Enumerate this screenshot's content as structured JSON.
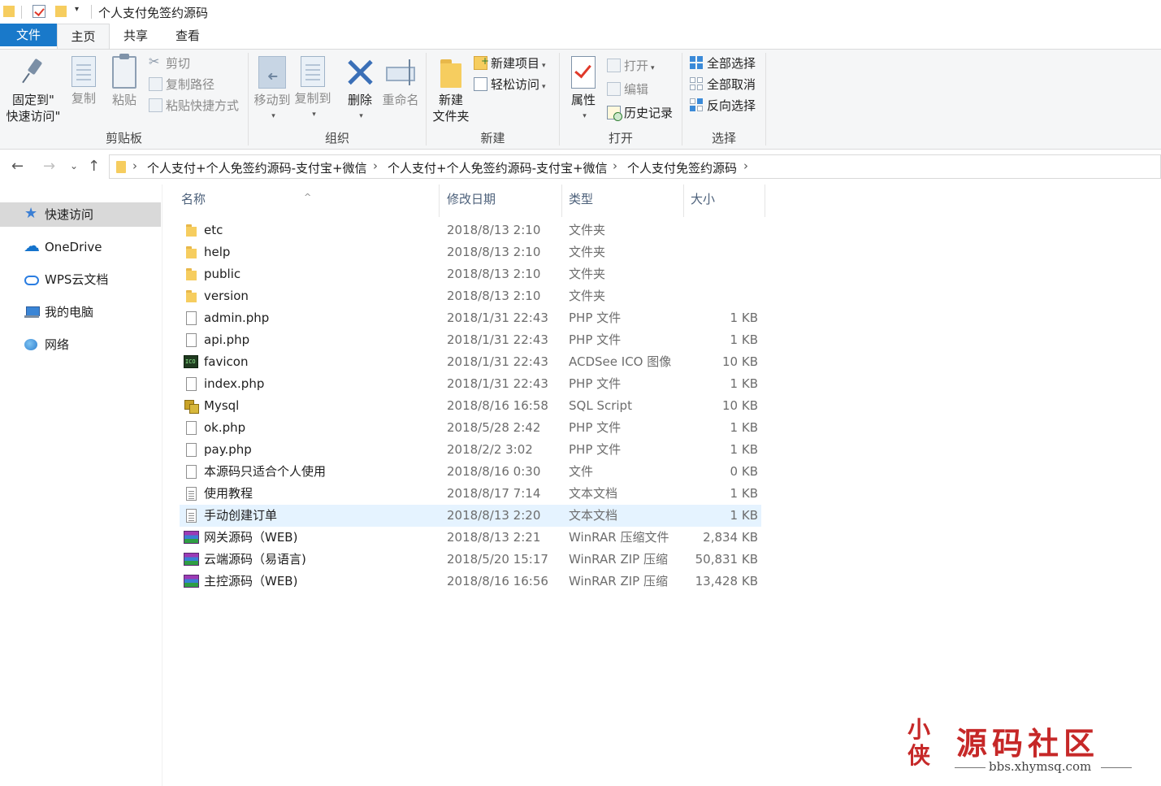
{
  "window": {
    "title": "个人支付免签约源码"
  },
  "ribbon_tabs": {
    "file": "文件",
    "home": "主页",
    "share": "共享",
    "view": "查看"
  },
  "ribbon": {
    "clipboard": {
      "label": "剪贴板",
      "pin_line1": "固定到\"",
      "pin_line2": "快速访问\"",
      "copy": "复制",
      "paste": "粘贴",
      "cut": "剪切",
      "copy_path": "复制路径",
      "paste_shortcut": "粘贴快捷方式"
    },
    "organize": {
      "label": "组织",
      "move_to": "移动到",
      "copy_to": "复制到",
      "delete": "删除",
      "rename": "重命名"
    },
    "new": {
      "label": "新建",
      "new_folder_line1": "新建",
      "new_folder_line2": "文件夹",
      "new_item": "新建项目",
      "easy_access": "轻松访问"
    },
    "open": {
      "label": "打开",
      "properties": "属性",
      "open": "打开",
      "edit": "编辑",
      "history": "历史记录"
    },
    "select": {
      "label": "选择",
      "select_all": "全部选择",
      "select_none": "全部取消",
      "invert": "反向选择"
    }
  },
  "address": {
    "crumbs": [
      "个人支付+个人免签约源码-支付宝+微信",
      "个人支付+个人免签约源码-支付宝+微信",
      "个人支付免签约源码"
    ]
  },
  "nav_pane": {
    "items": [
      {
        "label": "快速访问",
        "icon": "star-icon"
      },
      {
        "label": "OneDrive",
        "icon": "cloud-icon"
      },
      {
        "label": "WPS云文档",
        "icon": "wps-cloud-icon"
      },
      {
        "label": "我的电脑",
        "icon": "computer-icon"
      },
      {
        "label": "网络",
        "icon": "network-icon"
      }
    ]
  },
  "columns": {
    "name": "名称",
    "date": "修改日期",
    "type": "类型",
    "size": "大小"
  },
  "files": [
    {
      "name": "etc",
      "date": "2018/8/13 2:10",
      "type": "文件夹",
      "size": "",
      "icon": "folder"
    },
    {
      "name": "help",
      "date": "2018/8/13 2:10",
      "type": "文件夹",
      "size": "",
      "icon": "folder"
    },
    {
      "name": "public",
      "date": "2018/8/13 2:10",
      "type": "文件夹",
      "size": "",
      "icon": "folder"
    },
    {
      "name": "version",
      "date": "2018/8/13 2:10",
      "type": "文件夹",
      "size": "",
      "icon": "folder"
    },
    {
      "name": "admin.php",
      "date": "2018/1/31 22:43",
      "type": "PHP 文件",
      "size": "1 KB",
      "icon": "file"
    },
    {
      "name": "api.php",
      "date": "2018/1/31 22:43",
      "type": "PHP 文件",
      "size": "1 KB",
      "icon": "file"
    },
    {
      "name": "favicon",
      "date": "2018/1/31 22:43",
      "type": "ACDSee ICO 图像",
      "size": "10 KB",
      "icon": "ico"
    },
    {
      "name": "index.php",
      "date": "2018/1/31 22:43",
      "type": "PHP 文件",
      "size": "1 KB",
      "icon": "file"
    },
    {
      "name": "Mysql",
      "date": "2018/8/16 16:58",
      "type": "SQL Script",
      "size": "10 KB",
      "icon": "sql"
    },
    {
      "name": "ok.php",
      "date": "2018/5/28 2:42",
      "type": "PHP 文件",
      "size": "1 KB",
      "icon": "file"
    },
    {
      "name": "pay.php",
      "date": "2018/2/2 3:02",
      "type": "PHP 文件",
      "size": "1 KB",
      "icon": "file"
    },
    {
      "name": "本源码只适合个人使用",
      "date": "2018/8/16 0:30",
      "type": "文件",
      "size": "0 KB",
      "icon": "file"
    },
    {
      "name": "使用教程",
      "date": "2018/8/17 7:14",
      "type": "文本文档",
      "size": "1 KB",
      "icon": "text"
    },
    {
      "name": "手动创建订单",
      "date": "2018/8/13 2:20",
      "type": "文本文档",
      "size": "1 KB",
      "icon": "text",
      "selected": true
    },
    {
      "name": "网关源码（WEB)",
      "date": "2018/8/13 2:21",
      "type": "WinRAR 压缩文件",
      "size": "2,834 KB",
      "icon": "rar"
    },
    {
      "name": "云端源码（易语言)",
      "date": "2018/5/20 15:17",
      "type": "WinRAR ZIP 压缩",
      "size": "50,831 KB",
      "icon": "rar"
    },
    {
      "name": "主控源码（WEB)",
      "date": "2018/8/16 16:56",
      "type": "WinRAR ZIP 压缩",
      "size": "13,428 KB",
      "icon": "rar"
    }
  ],
  "watermark": {
    "seal": "小侠",
    "title": "源码社区",
    "url": "bbs.xhymsq.com"
  },
  "colors": {
    "file_tab": "#1979ca",
    "selection": "#e5f3ff",
    "nav_selection": "#d9d9d9",
    "watermark": "#c62828"
  }
}
